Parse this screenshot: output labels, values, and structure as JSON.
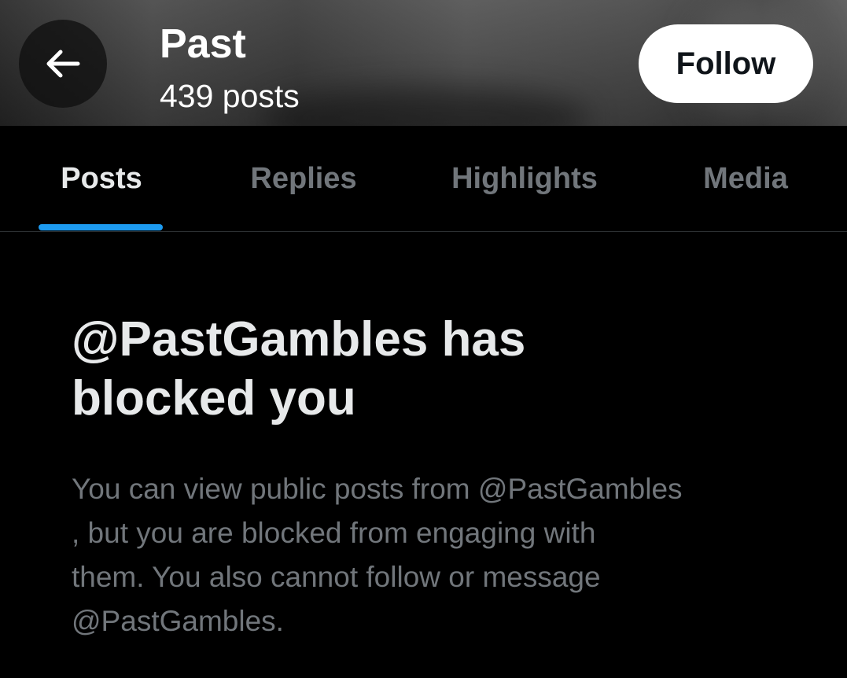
{
  "header": {
    "back_icon": "arrow-left-icon",
    "title": "Past",
    "post_count": "439 posts",
    "follow_label": "Follow"
  },
  "tabs": [
    {
      "label": "Posts",
      "active": true
    },
    {
      "label": "Replies",
      "active": false
    },
    {
      "label": "Highlights",
      "active": false
    },
    {
      "label": "Media",
      "active": false
    }
  ],
  "blocked": {
    "title_line1": "@PastGambles has",
    "title_line2": "blocked you",
    "desc_lines": [
      "You can view public posts from @PastGambles",
      ", but you are blocked from engaging with",
      "them. You also cannot follow or message",
      "@PastGambles."
    ]
  },
  "colors": {
    "accent": "#1d9bf0",
    "background": "#000000",
    "primary_text": "#e7e9ea",
    "secondary_text": "#71767b"
  }
}
